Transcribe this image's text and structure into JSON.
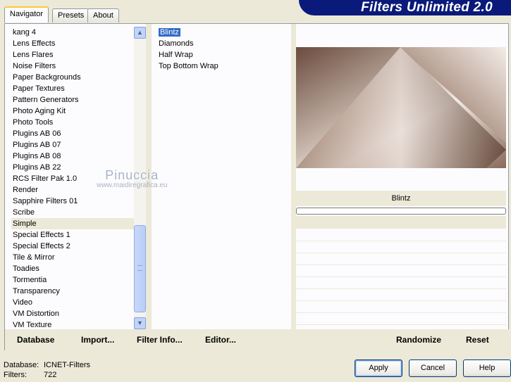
{
  "tabs": [
    {
      "label": "Navigator"
    },
    {
      "label": "Presets"
    },
    {
      "label": "About"
    }
  ],
  "banner": {
    "title": "Filters Unlimited 2.0"
  },
  "categories": [
    "kang 4",
    "Lens Effects",
    "Lens Flares",
    "Noise Filters",
    "Paper Backgrounds",
    "Paper Textures",
    "Pattern Generators",
    "Photo Aging Kit",
    "Photo Tools",
    "Plugins AB 06",
    "Plugins AB 07",
    "Plugins AB 08",
    "Plugins AB 22",
    "RCS Filter Pak 1.0",
    "Render",
    "Sapphire Filters 01",
    "Scribe",
    "Simple",
    "Special Effects 1",
    "Special Effects 2",
    "Tile & Mirror",
    "Toadies",
    "Tormentia",
    "Transparency",
    "Video",
    "VM Distortion",
    "VM Texture"
  ],
  "selected_category": "Simple",
  "filters": [
    "Blintz",
    "Diamonds",
    "Half Wrap",
    "Top Bottom Wrap"
  ],
  "selected_filter": "Blintz",
  "preview": {
    "filter_name": "Blintz"
  },
  "watermark": {
    "line1": "Pinuccia",
    "line2": "www.maidiregrafica.eu"
  },
  "left_buttons": {
    "database": "Database",
    "import": "Import...",
    "filter_info": "Filter Info...",
    "editor": "Editor..."
  },
  "right_buttons": {
    "randomize": "Randomize",
    "reset": "Reset"
  },
  "status": {
    "database_label": "Database:",
    "database_value": "ICNET-Filters",
    "filters_label": "Filters:",
    "filters_value": "722"
  },
  "dialog_buttons": {
    "apply": "Apply",
    "cancel": "Cancel",
    "help": "Help"
  },
  "colors": {
    "banner": "#0a1a7a",
    "selection": "#316ac5",
    "tab_highlight": "#ffc83c"
  }
}
